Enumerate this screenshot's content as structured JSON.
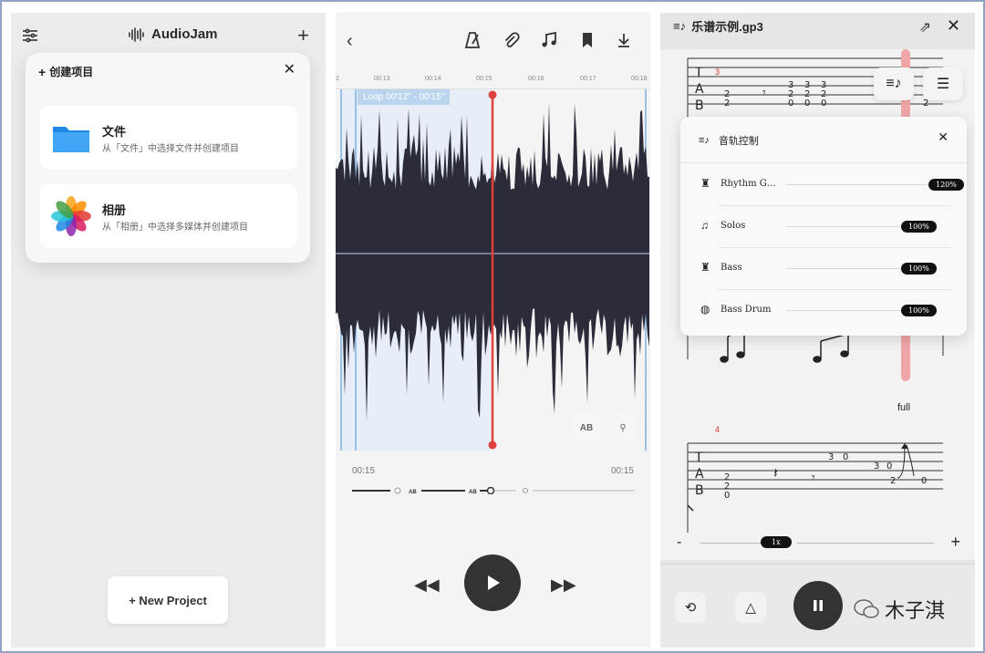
{
  "panel1": {
    "app_name": "AudioJam",
    "menu_icon": "sliders-icon",
    "add_icon": "plus-icon",
    "create_card": {
      "title": "创建项目",
      "options": [
        {
          "title": "文件",
          "subtitle": "从「文件」中选择文件并创建项目",
          "icon": "folder-icon"
        },
        {
          "title": "相册",
          "subtitle": "从「相册」中选择多媒体并创建项目",
          "icon": "photos-icon"
        }
      ]
    },
    "new_project_label": "+ New Project"
  },
  "panel2": {
    "toolbar_icons": [
      "back-icon",
      "metronome-icon",
      "attachment-icon",
      "music-note-icon",
      "bookmark-icon",
      "download-icon"
    ],
    "ruler_labels": [
      "2",
      "00:13",
      "00:14",
      "00:15",
      "00:16",
      "00:17",
      "00:18"
    ],
    "loop_label": "Loop 00'12\" - 00'15\"",
    "ab_label": "AB",
    "time_left": "00:15",
    "time_right": "00:15",
    "accent_color": "#e0403c"
  },
  "panel3": {
    "file_title": "乐谱示例.gp3",
    "measure_numbers": [
      "3",
      "4"
    ],
    "bend_label": "full",
    "track_popup": {
      "title": "音轨控制",
      "tracks": [
        {
          "name": "Rhythm G…",
          "volume": "120%",
          "icon": "guitar-amp-icon"
        },
        {
          "name": "Solos",
          "volume": "100%",
          "icon": "music-note-icon"
        },
        {
          "name": "Bass",
          "volume": "100%",
          "icon": "guitar-amp-icon"
        },
        {
          "name": "Bass Drum",
          "volume": "100%",
          "icon": "drum-icon"
        }
      ]
    },
    "speed_minus": "-",
    "speed_value": "1x",
    "speed_plus": "+",
    "watermark": "木子淇"
  }
}
